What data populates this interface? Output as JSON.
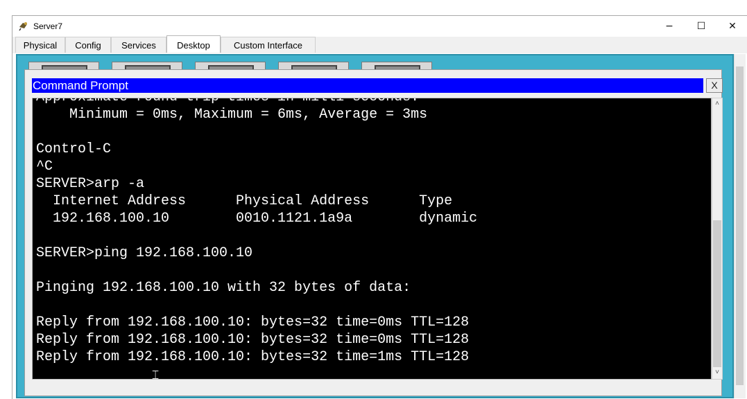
{
  "window": {
    "title": "Server7",
    "minimize_icon": "minimize-icon",
    "maximize_icon": "maximize-icon",
    "close_icon": "close-icon",
    "minimize_glyph": "−",
    "maximize_glyph": "☐",
    "close_glyph": "✕"
  },
  "tabs": [
    "Physical",
    "Config",
    "Services",
    "Desktop",
    "Custom Interface"
  ],
  "active_tab": "Desktop",
  "command_prompt": {
    "title": "Command Prompt",
    "close_label": "X",
    "lines": [
      "Approximate round trip times in milli-seconds:",
      "    Minimum = 0ms, Maximum = 6ms, Average = 3ms",
      "",
      "Control-C",
      "^C",
      "SERVER>arp -a",
      "  Internet Address      Physical Address      Type",
      "  192.168.100.10        0010.1121.1a9a        dynamic",
      "",
      "SERVER>ping 192.168.100.10",
      "",
      "Pinging 192.168.100.10 with 32 bytes of data:",
      "",
      "Reply from 192.168.100.10: bytes=32 time=0ms TTL=128",
      "Reply from 192.168.100.10: bytes=32 time=0ms TTL=128",
      "Reply from 192.168.100.10: bytes=32 time=1ms TTL=128",
      ""
    ]
  },
  "colors": {
    "desktop_bg": "#3fb1cc",
    "cmd_titlebar": "#0000ff",
    "terminal_bg": "#000000",
    "terminal_text": "#ffffff"
  }
}
